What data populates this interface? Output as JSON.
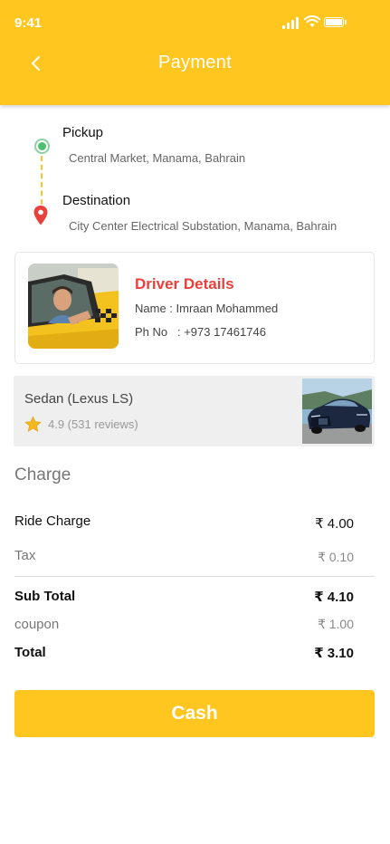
{
  "status_bar": {
    "time": "9:41"
  },
  "header": {
    "title": "Payment",
    "back_icon": "chevron-left-icon"
  },
  "route": {
    "pickup_label": "Pickup",
    "pickup_address": "Central Market, Manama, Bahrain",
    "destination_label": "Destination",
    "destination_address": "City Center Electrical Substation, Manama, Bahrain"
  },
  "driver": {
    "title": "Driver Details",
    "name": "Name : Imraan Mohammed",
    "phone": "Ph No   : +973 17461746"
  },
  "car": {
    "name": "Sedan (Lexus LS)",
    "rating": "4.9 (531 reviews)"
  },
  "charges": {
    "heading": "Charge",
    "rows": [
      {
        "label": "Ride Charge",
        "amount": "₹ 4.00"
      },
      {
        "label": "Tax",
        "amount": "₹ 0.10"
      },
      {
        "label": "Sub Total",
        "amount": "₹ 4.10"
      },
      {
        "label": "coupon",
        "amount": "₹ 1.00"
      },
      {
        "label": "Total",
        "amount": "₹ 3.10"
      }
    ]
  },
  "actions": {
    "pay_button": "Cash"
  },
  "colors": {
    "accent": "#FFC61F",
    "driver_title": "#E8413B",
    "pickup_dot": "#4CC06E",
    "pin": "#E8413B"
  }
}
